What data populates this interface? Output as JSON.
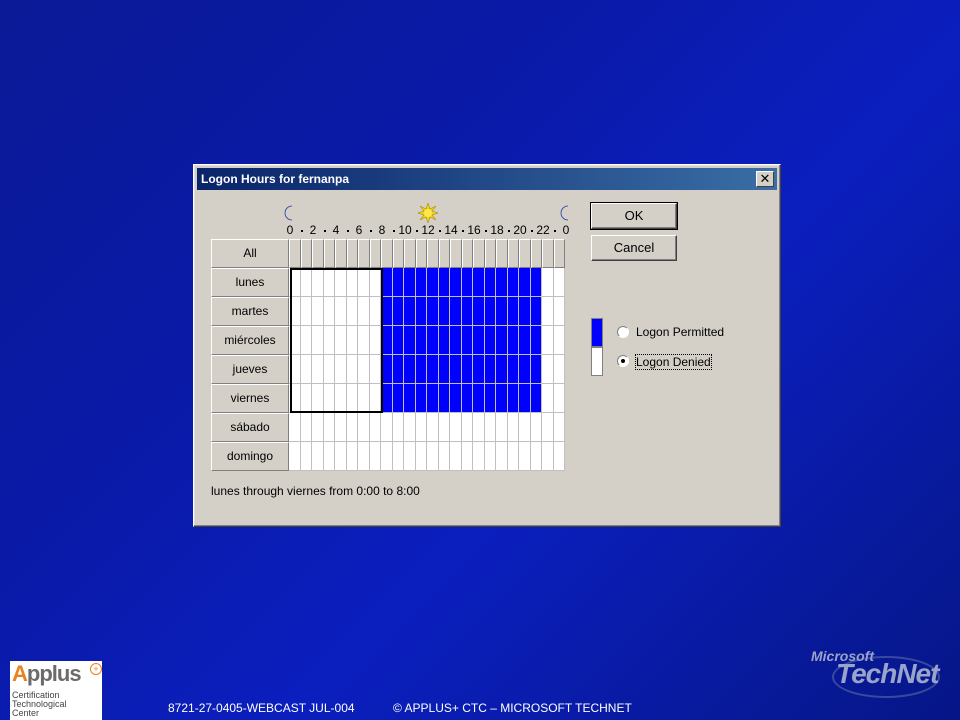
{
  "dialog": {
    "title": "Logon Hours for fernanpa",
    "close_label": "✕",
    "hour_labels": [
      "0",
      "2",
      "4",
      "6",
      "8",
      "10",
      "12",
      "14",
      "16",
      "18",
      "20",
      "22",
      "0"
    ],
    "all_label": "All",
    "days": [
      "lunes",
      "martes",
      "miércoles",
      "jueves",
      "viernes",
      "sábado",
      "domingo"
    ],
    "permitted_hours": {
      "lunes": [
        8,
        22
      ],
      "martes": [
        8,
        22
      ],
      "miércoles": [
        8,
        22
      ],
      "jueves": [
        8,
        22
      ],
      "viernes": [
        8,
        22
      ],
      "sábado": [],
      "domingo": []
    },
    "selection": {
      "days": [
        "lunes",
        "martes",
        "miércoles",
        "jueves",
        "viernes"
      ],
      "hours": [
        0,
        8
      ]
    },
    "ok_label": "OK",
    "cancel_label": "Cancel",
    "legend": {
      "permitted_color": "#0000ff",
      "denied_color": "#ffffff",
      "permitted_label": "Logon Permitted",
      "denied_label": "Logon Denied",
      "selected": "denied"
    },
    "status": "lunes through viernes from 0:00 to 8:00"
  },
  "footer": {
    "logo_word_a": "A",
    "logo_word_rest": "pplus",
    "logo_plus": "+",
    "logo_sub": [
      "Certification",
      "Technological",
      "Center"
    ],
    "webcast": "8721-27-0405-WEBCAST  JUL-004",
    "copyright": "© APPLUS+ CTC – MICROSOFT  TECHNET",
    "brand_top": "Microsoft",
    "brand_main": "TechNet"
  },
  "icons": {
    "moon": "moon-icon",
    "sun": "sun-icon",
    "close": "close-icon"
  }
}
